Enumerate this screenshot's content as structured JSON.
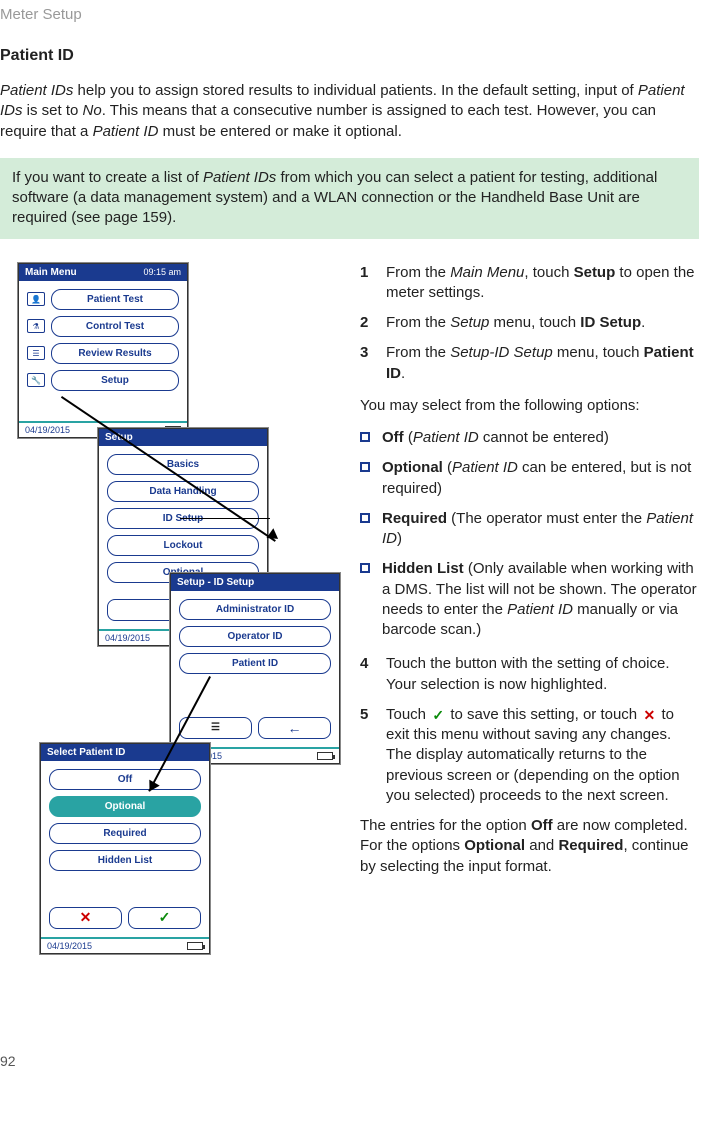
{
  "breadcrumb": "Meter Setup",
  "section_title": "Patient ID",
  "intro_html": "Patient IDs help you to assign stored results to individual patients. In the default setting, input of Patient IDs is set to No. This means that a consecutive number is assigned to each test. However, you can require that a Patient ID must be entered or make it optional.",
  "note": "If you want to create a list of Patient IDs from which you can select a patient for testing, additional software (a data management system) and a WLAN connection or the Handheld Base Unit are required (see page 159).",
  "steps": {
    "s1": {
      "n": "1",
      "text": "From the Main Menu, touch Setup to open the meter settings."
    },
    "s2": {
      "n": "2",
      "text": "From the Setup menu, touch ID Setup."
    },
    "s3": {
      "n": "3",
      "text": "From the Setup-ID Setup menu, touch Patient ID."
    },
    "s4": {
      "n": "4",
      "text": "Touch the button with the setting of choice. Your selection is now highlighted."
    },
    "s5": {
      "n": "5",
      "text_a": "Touch ",
      "text_b": " to save this setting, or touch ",
      "text_c": " to exit this menu without saving any changes. The display automatically returns to the previous screen or (depending on the option you selected) proceeds to the next screen."
    }
  },
  "options_intro": "You may select from the following options:",
  "options": {
    "o1": {
      "label": "Off",
      "desc": " (Patient ID cannot be entered)"
    },
    "o2": {
      "label": "Optional",
      "desc": " (Patient ID can be entered, but is not required)"
    },
    "o3": {
      "label": "Required",
      "desc": " (The operator must enter the Patient ID)"
    },
    "o4": {
      "label": "Hidden List",
      "desc": " (Only available when working with a DMS. The list will not be shown. The operator needs to enter the Patient ID manually or via barcode scan.)"
    }
  },
  "finish": "The entries for the option Off are now completed. For the options Optional and Required, continue by selecting the input format.",
  "main_menu": {
    "title": "Main Menu",
    "time": "09:15 am",
    "patient_test": "Patient Test",
    "control_test": "Control Test",
    "review_results": "Review Results",
    "setup": "Setup",
    "date": "04/19/2015"
  },
  "setup_menu": {
    "title": "Setup",
    "basics": "Basics",
    "data_handling": "Data Handling",
    "id_setup": "ID Setup",
    "lockout": "Lockout",
    "optional": "Optional",
    "date": "04/19/2015"
  },
  "id_setup_menu": {
    "title": "Setup - ID Setup",
    "admin_id": "Administrator ID",
    "operator_id": "Operator ID",
    "patient_id": "Patient ID",
    "date": "04/19/2015"
  },
  "select_patient": {
    "title": "Select Patient ID",
    "off": "Off",
    "optional": "Optional",
    "required": "Required",
    "hidden": "Hidden List",
    "date": "04/19/2015"
  },
  "page_num": "92"
}
